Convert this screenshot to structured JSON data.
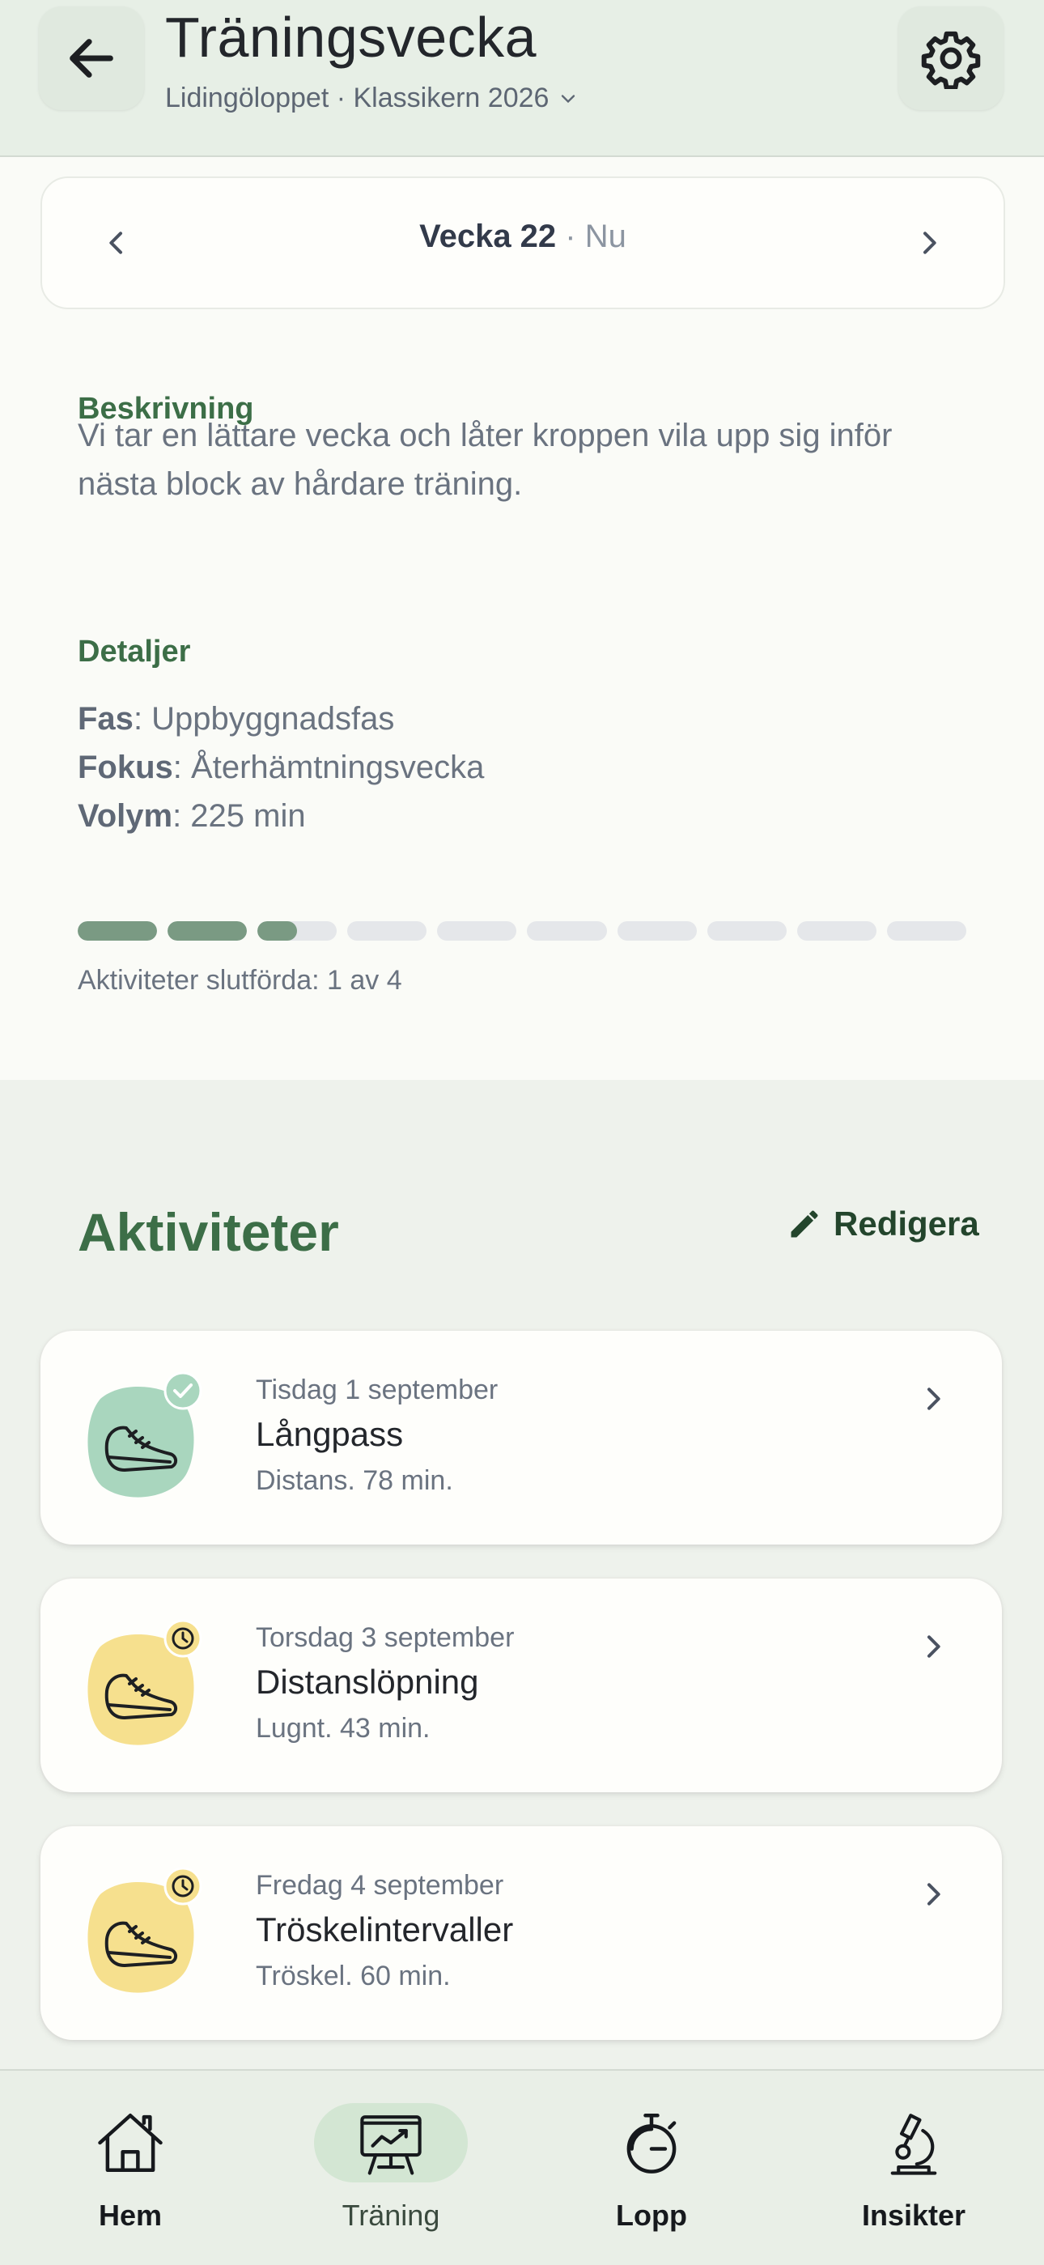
{
  "header": {
    "title": "Träningsvecka",
    "subtitle": "Lidingöloppet · Klassikern 2026",
    "back_icon": "arrow-left-icon",
    "settings_icon": "gear-icon"
  },
  "week": {
    "label": "Vecka 22",
    "separator": "·",
    "status": "Nu"
  },
  "description": {
    "heading": "Beskrivning",
    "text": "Vi tar en lättare vecka och låter kroppen vila upp sig inför nästa block av hårdare träning."
  },
  "details": {
    "heading": "Detaljer",
    "rows": [
      {
        "key": "Fas",
        "value": ": Uppbyggnadsfas"
      },
      {
        "key": "Fokus",
        "value": ": Återhämtningsvecka"
      },
      {
        "key": "Volym",
        "value": ": 225 min"
      }
    ]
  },
  "progress": {
    "segments": 10,
    "fraction": 0.25,
    "text": "Aktiviteter slutförda: 1 av 4"
  },
  "activities": {
    "title": "Aktiviteter",
    "edit_label": "Redigera",
    "items": [
      {
        "date": "Tisdag 1 september",
        "name": "Långpass",
        "meta": "Distans. 78 min.",
        "status": "done",
        "status_icon": "check-icon",
        "blob_color": "#a9d6be"
      },
      {
        "date": "Torsdag 3 september",
        "name": "Distanslöpning",
        "meta": "Lugnt. 43 min.",
        "status": "scheduled",
        "status_icon": "clock-icon",
        "blob_color": "#f6e08e"
      },
      {
        "date": "Fredag 4 september",
        "name": "Tröskelintervaller",
        "meta": "Tröskel. 60 min.",
        "status": "scheduled",
        "status_icon": "clock-icon",
        "blob_color": "#f6e08e"
      }
    ]
  },
  "nav": {
    "items": [
      {
        "label": "Hem",
        "icon": "house-icon"
      },
      {
        "label": "Träning",
        "icon": "training-board-icon",
        "active": true
      },
      {
        "label": "Lopp",
        "icon": "stopwatch-icon"
      },
      {
        "label": "Insikter",
        "icon": "microscope-icon"
      }
    ]
  },
  "colors": {
    "accent": "#3c6e47",
    "done": "#a9d6be",
    "scheduled": "#f6e08e",
    "progress_fill": "#7a9a83"
  }
}
